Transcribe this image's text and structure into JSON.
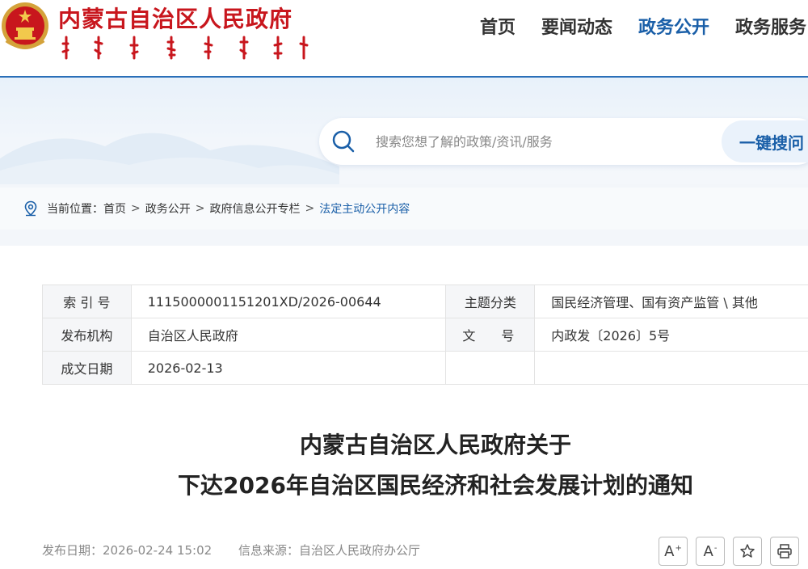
{
  "header": {
    "site_title": "内蒙古自治区人民政府",
    "nav": [
      "首页",
      "要闻动态",
      "政务公开",
      "政务服务"
    ],
    "active_nav_index": 2,
    "colors": {
      "brand_red": "#c8161d",
      "accent_blue": "#1a5fa8"
    }
  },
  "search": {
    "placeholder": "搜索您想了解的政策/资讯/服务",
    "button_label": "一键搜问",
    "icon": "search-icon"
  },
  "breadcrumb": {
    "prefix": "当前位置：",
    "items": [
      "首页",
      "政务公开",
      "政府信息公开专栏"
    ],
    "current": "法定主动公开内容",
    "separator": ">",
    "icon": "location-pin-icon"
  },
  "meta_table": {
    "rows": [
      {
        "k1": "索 引 号",
        "v1": "1115000001151201XD/2026-00644",
        "k2": "主题分类",
        "v2": "国民经济管理、国有资产监管 \\ 其他"
      },
      {
        "k1": "发布机构",
        "v1": "自治区人民政府",
        "k2": "文　　号",
        "v2": "内政发〔2026〕5号"
      },
      {
        "k1": "成文日期",
        "v1": "2026-02-13",
        "k2": "",
        "v2": ""
      }
    ]
  },
  "document": {
    "title_line1": "内蒙古自治区人民政府关于",
    "title_line2": "下达2026年自治区国民经济和社会发展计划的通知",
    "publish_date": "发布日期：2026-02-24 15:02",
    "source": "信息来源：自治区人民政府办公厅"
  },
  "tools": {
    "font_increase": "A",
    "font_decrease": "A",
    "increase_mark": "+",
    "decrease_mark": "-",
    "icons": [
      "font-increase-icon",
      "font-decrease-icon",
      "star-icon",
      "print-icon"
    ]
  }
}
